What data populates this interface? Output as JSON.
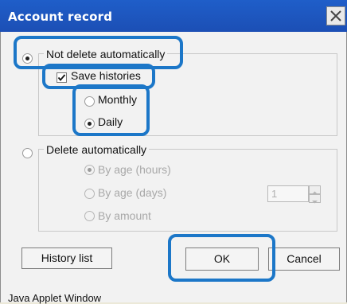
{
  "window": {
    "title": "Account record",
    "close_glyph": "✕",
    "status_text": "Java Applet Window"
  },
  "options": {
    "not_delete": {
      "label": "Not delete automatically",
      "selected": true
    },
    "save_histories": {
      "label": "Save histories",
      "checked": true
    },
    "monthly": {
      "label": "Monthly",
      "selected": false
    },
    "daily": {
      "label": "Daily",
      "selected": true
    },
    "delete": {
      "label": "Delete automatically",
      "selected": false
    },
    "by_age_hours": {
      "label": "By age (hours)",
      "selected": true,
      "enabled": false
    },
    "by_age_days": {
      "label": "By age (days)",
      "selected": false,
      "enabled": false
    },
    "by_amount": {
      "label": "By amount",
      "selected": false,
      "enabled": false
    },
    "days_value": "1"
  },
  "buttons": {
    "history_list": "History list",
    "ok": "OK",
    "cancel": "Cancel"
  },
  "colors": {
    "highlight": "#1c77c8",
    "titlebar": "#1f5ec9"
  },
  "icons": {
    "close": "close-icon",
    "check": "check-icon",
    "spin_up": "spin-up-icon",
    "spin_down": "spin-down-icon"
  }
}
